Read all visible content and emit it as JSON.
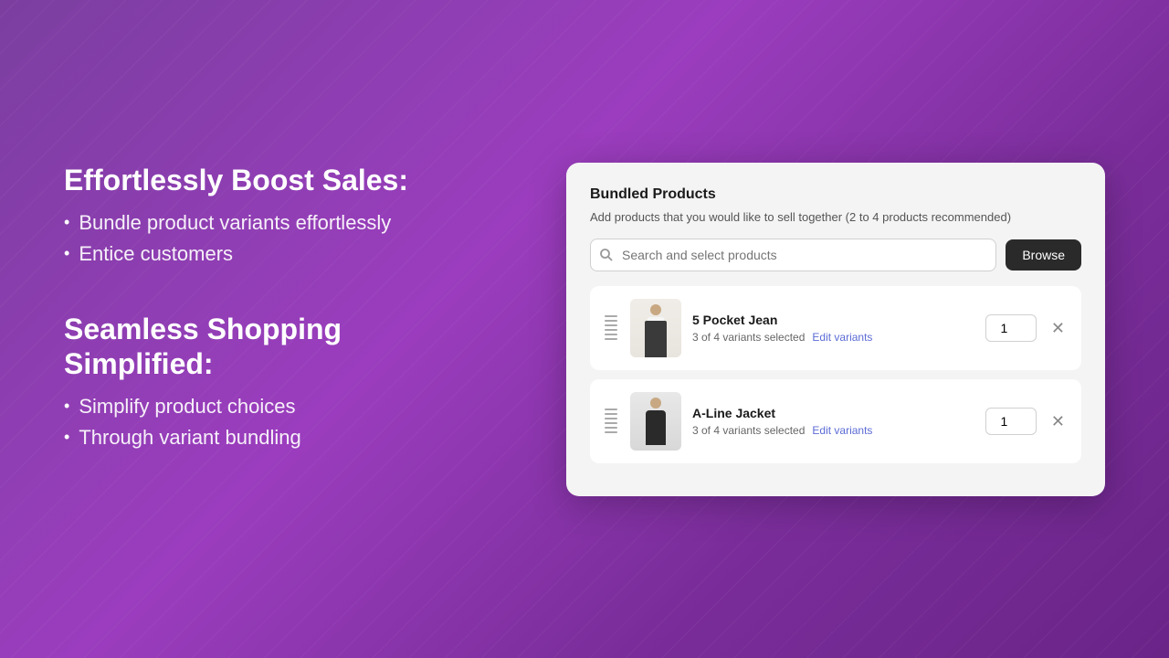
{
  "left": {
    "section1": {
      "title": "Effortlessly Boost Sales:",
      "bullets": [
        "Bundle product variants effortlessly",
        "Entice customers"
      ]
    },
    "section2": {
      "title": "Seamless Shopping Simplified:",
      "bullets": [
        "Simplify product choices",
        "Through variant bundling"
      ]
    }
  },
  "card": {
    "title": "Bundled Products",
    "subtitle": "Add products that you would like to sell together (2 to 4 products recommended)",
    "search_placeholder": "Search and select products",
    "browse_label": "Browse",
    "products": [
      {
        "name": "5 Pocket Jean",
        "variants_text": "3 of 4 variants selected",
        "edit_label": "Edit variants",
        "quantity": 1,
        "type": "jean"
      },
      {
        "name": "A-Line Jacket",
        "variants_text": "3 of 4 variants selected",
        "edit_label": "Edit variants",
        "quantity": 1,
        "type": "jacket"
      }
    ]
  }
}
